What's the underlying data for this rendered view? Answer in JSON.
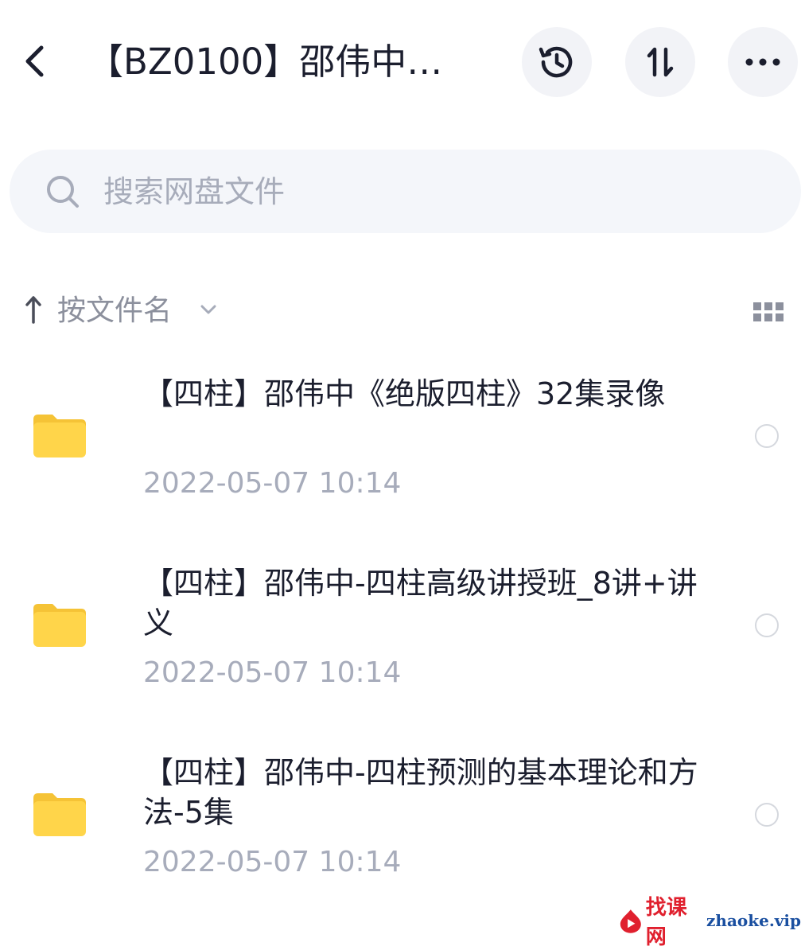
{
  "header": {
    "title": "【BZ0100】邵伟中…",
    "icons": {
      "back": "chevron-left-icon",
      "history": "history-icon",
      "transfer": "transfer-icon",
      "more": "more-horizontal-icon"
    }
  },
  "search": {
    "placeholder": "搜索网盘文件",
    "value": "",
    "icon": "search-icon"
  },
  "sort": {
    "label": "按文件名",
    "icons": {
      "arrow": "arrow-up-icon",
      "chevron": "chevron-down-icon",
      "view": "grid-view-icon"
    }
  },
  "files": [
    {
      "name": "【四柱】邵伟中《绝版四柱》32集录像",
      "date": "2022-05-07  10:14",
      "icon": "folder-icon"
    },
    {
      "name": "【四柱】邵伟中-四柱高级讲授班_8讲+讲义",
      "date": "2022-05-07  10:14",
      "icon": "folder-icon"
    },
    {
      "name": "【四柱】邵伟中-四柱预测的基本理论和方法-5集",
      "date": "2022-05-07  10:14",
      "icon": "folder-icon"
    }
  ],
  "watermark": {
    "cn": "找课网",
    "en": "zhaoke.vip"
  },
  "colors": {
    "folder": "#FFD54A",
    "folder_tab": "#F5C336",
    "text": "#1B1E2E",
    "secondary": "#A7ACBB",
    "button_bg": "#F2F3F7",
    "search_bg": "#F4F6FA"
  }
}
